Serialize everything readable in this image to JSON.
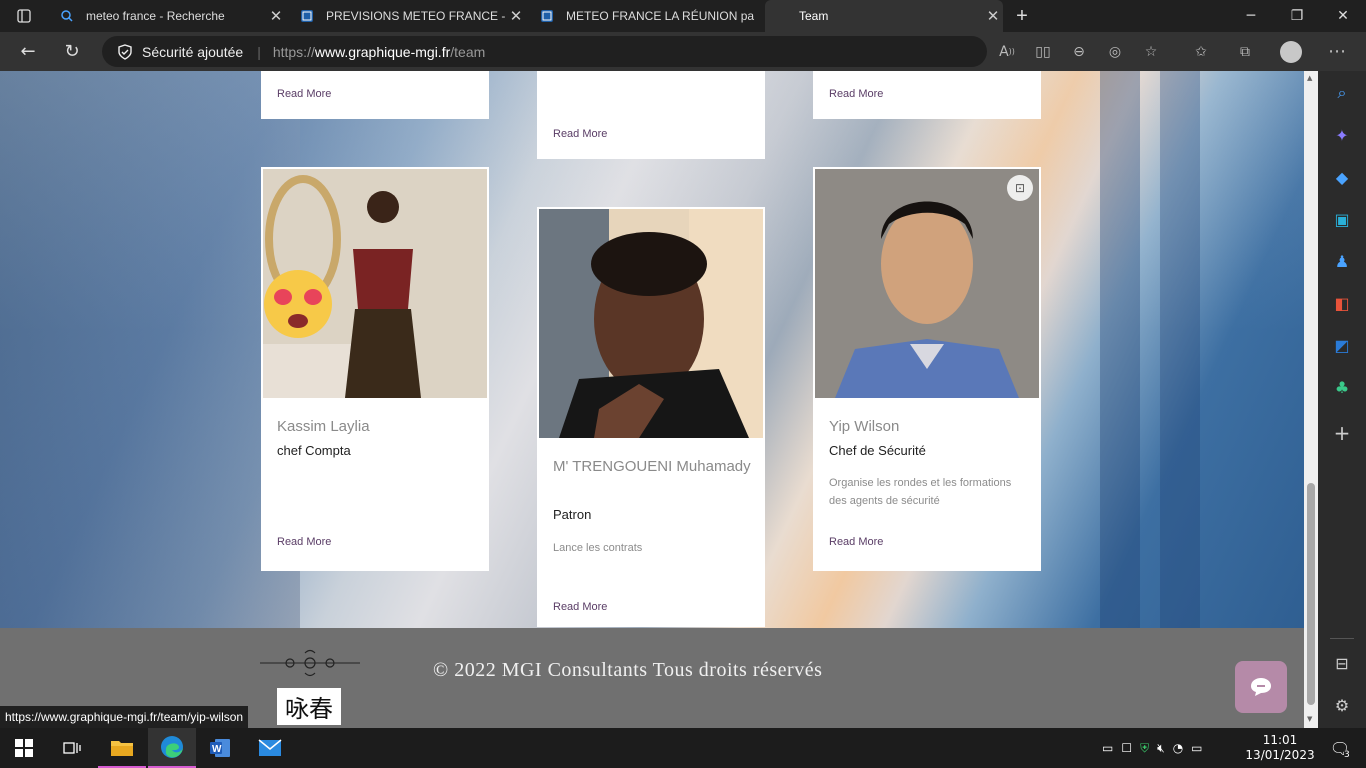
{
  "browser": {
    "tabs": [
      {
        "title": "meteo france - Recherche"
      },
      {
        "title": "PREVISIONS METEO FRANCE - Si"
      },
      {
        "title": "METEO FRANCE LA RÉUNION pa"
      },
      {
        "title": "Team"
      }
    ],
    "security_label": "Sécurité ajoutée",
    "url_prefix": "https://",
    "url_domain": "www.graphique-mgi.fr",
    "url_path": "/team",
    "status_url": "https://www.graphique-mgi.fr/team/yip-wilson"
  },
  "team": {
    "read_more": "Read More",
    "members": [
      {
        "name": "Kassim Laylia",
        "role": "chef Compta",
        "description": ""
      },
      {
        "name": "M' TRENGOUENI Muhamady",
        "role": "Patron",
        "description": "Lance les contrats"
      },
      {
        "name": "Yip Wilson",
        "role": "Chef de Sécurité",
        "description": "Organise les rondes et les formations des agents de sécurité"
      }
    ]
  },
  "footer": {
    "copyright": "© 2022 MGI Consultants Tous droits réservés",
    "logo_text": "咏春"
  },
  "taskbar": {
    "time": "11:01",
    "date": "13/01/2023",
    "notifications": "3"
  },
  "colors": {
    "accent_link": "#5a3d66",
    "chat_button": "#b58aa8"
  }
}
